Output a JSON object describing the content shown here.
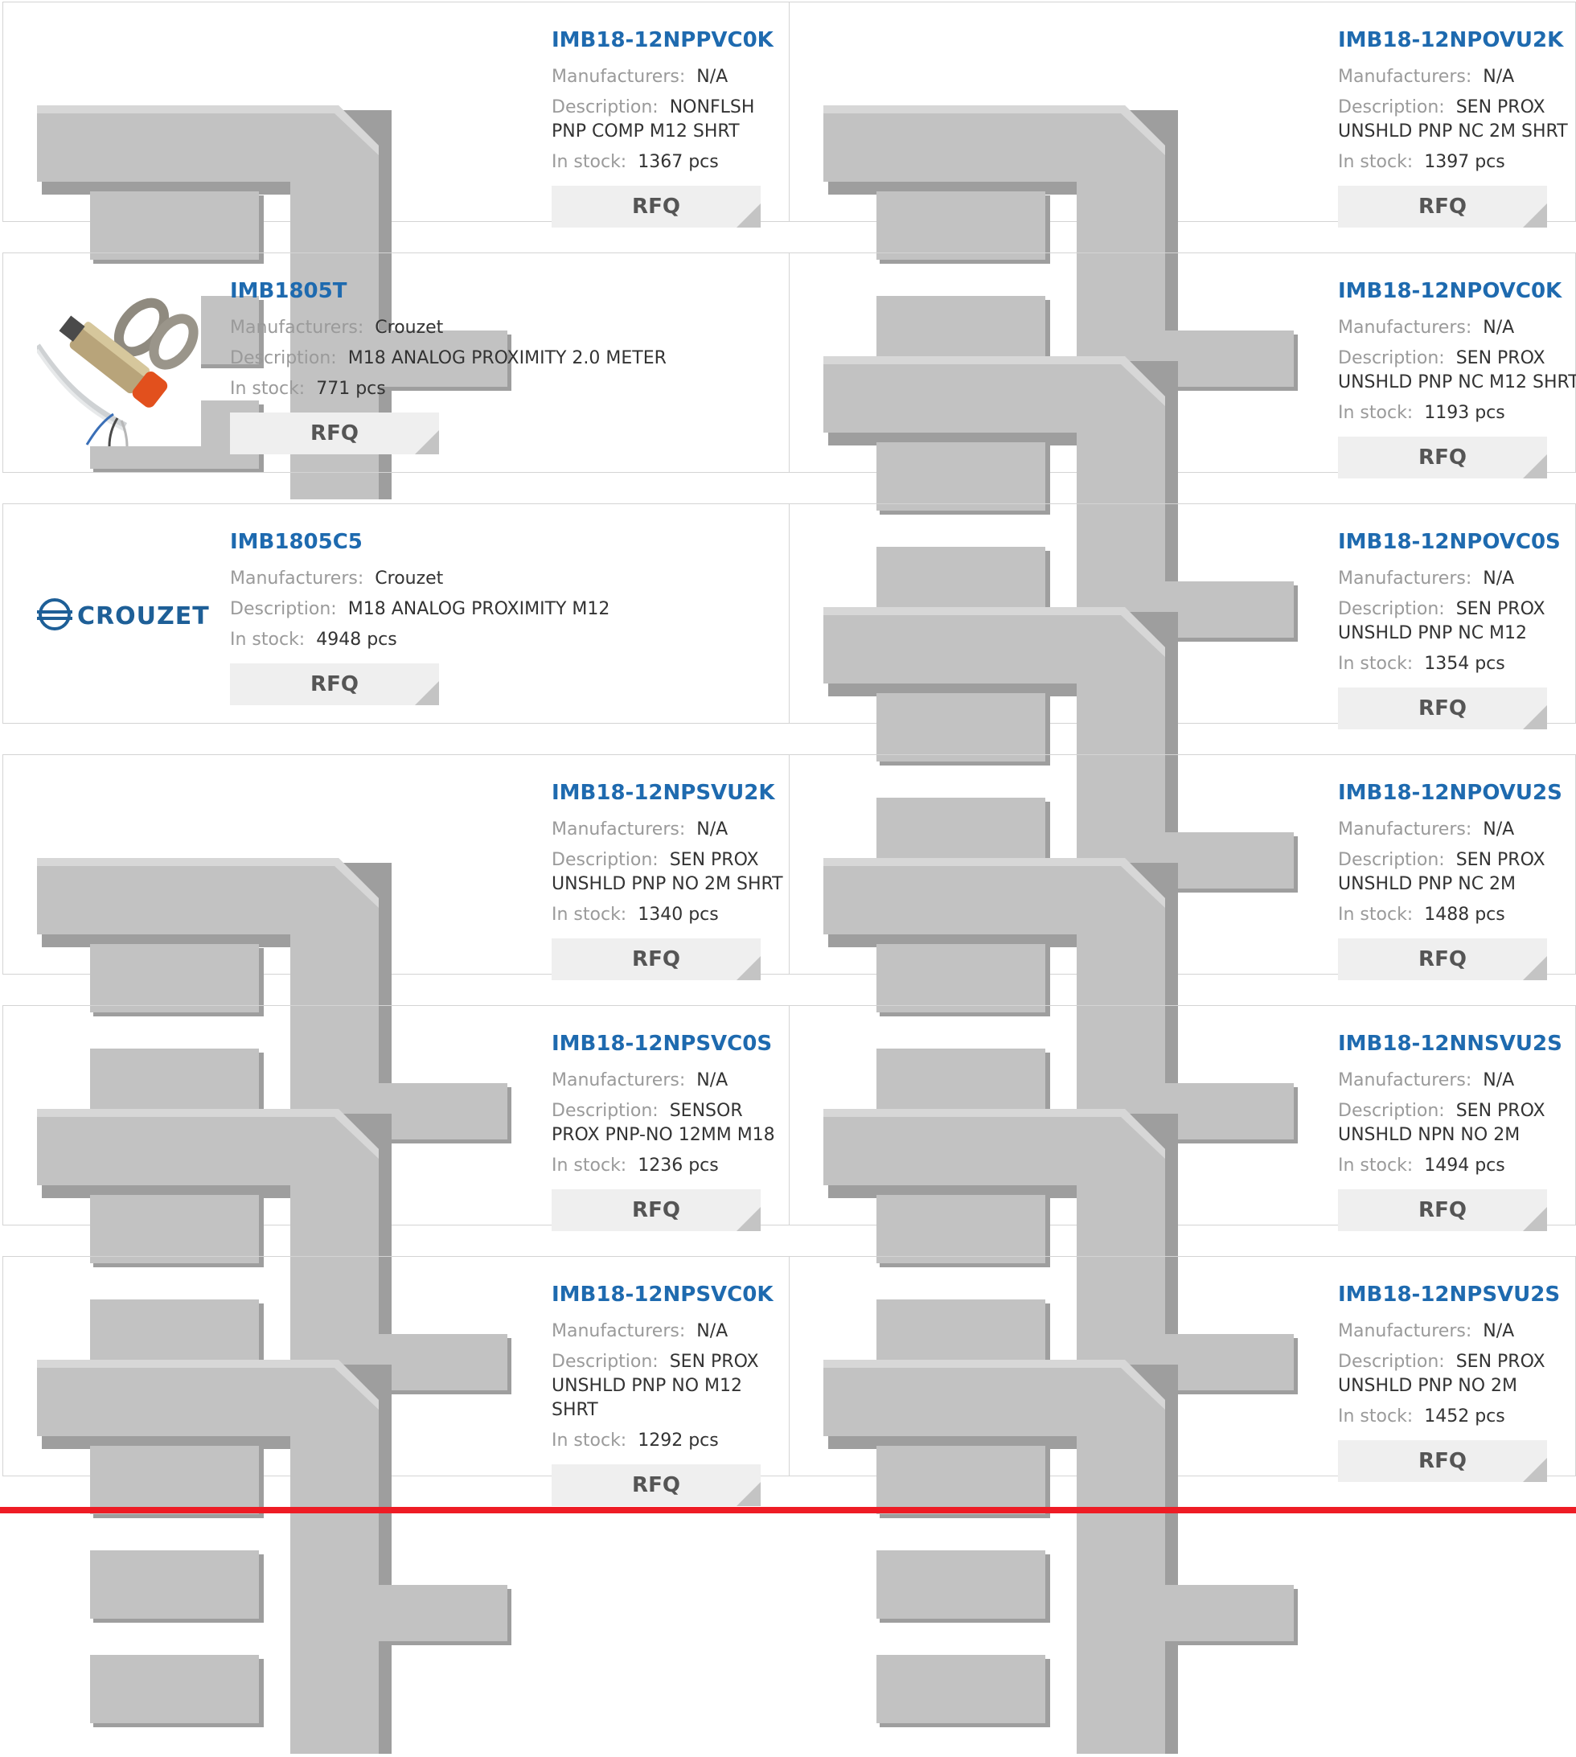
{
  "labels": {
    "manufacturers": "Manufacturers:",
    "description": "Description:",
    "in_stock": "In stock:",
    "rfq": "RFQ"
  },
  "colors": {
    "part_number": "#1e6aaf",
    "label": "#9a9a9a",
    "value": "#333333",
    "rfq_bg": "#efefef",
    "bottom_bar": "#ee1c25"
  },
  "products": [
    {
      "part": "IMB18-12NPPVC0K",
      "manufacturer": "N/A",
      "description": "NONFLSH PNP COMP M12 SHRT",
      "stock": "1367 pcs",
      "image": "placeholder"
    },
    {
      "part": "IMB18-12NPOVU2K",
      "manufacturer": "N/A",
      "description": "SEN PROX UNSHLD PNP NC 2M SHRT",
      "stock": "1397 pcs",
      "image": "placeholder"
    },
    {
      "part": "IMB1805T",
      "manufacturer": "Crouzet",
      "description": "M18 ANALOG PROXIMITY 2.0 METER",
      "stock": "771 pcs",
      "image": "photo"
    },
    {
      "part": "IMB18-12NPOVC0K",
      "manufacturer": "N/A",
      "description": "SEN PROX UNSHLD PNP NC M12 SHRT",
      "stock": "1193 pcs",
      "image": "placeholder"
    },
    {
      "part": "IMB1805C5",
      "manufacturer": "Crouzet",
      "description": "M18 ANALOG PROXIMITY M12",
      "stock": "4948 pcs",
      "image": "logo",
      "logo_text": "CROUZET"
    },
    {
      "part": "IMB18-12NPOVC0S",
      "manufacturer": "N/A",
      "description": "SEN PROX UNSHLD PNP NC M12",
      "stock": "1354 pcs",
      "image": "placeholder"
    },
    {
      "part": "IMB18-12NPSVU2K",
      "manufacturer": "N/A",
      "description": "SEN PROX UNSHLD PNP NO 2M SHRT",
      "stock": "1340 pcs",
      "image": "placeholder"
    },
    {
      "part": "IMB18-12NPOVU2S",
      "manufacturer": "N/A",
      "description": "SEN PROX UNSHLD PNP NC 2M",
      "stock": "1488 pcs",
      "image": "placeholder"
    },
    {
      "part": "IMB18-12NPSVC0S",
      "manufacturer": "N/A",
      "description": "SENSOR PROX PNP-NO 12MM M18",
      "stock": "1236 pcs",
      "image": "placeholder"
    },
    {
      "part": "IMB18-12NNSVU2S",
      "manufacturer": "N/A",
      "description": "SEN PROX UNSHLD NPN NO 2M",
      "stock": "1494 pcs",
      "image": "placeholder"
    },
    {
      "part": "IMB18-12NPSVC0K",
      "manufacturer": "N/A",
      "description": "SEN PROX UNSHLD PNP NO M12 SHRT",
      "stock": "1292 pcs",
      "image": "placeholder"
    },
    {
      "part": "IMB18-12NPSVU2S",
      "manufacturer": "N/A",
      "description": "SEN PROX UNSHLD PNP NO 2M",
      "stock": "1452 pcs",
      "image": "placeholder"
    }
  ]
}
